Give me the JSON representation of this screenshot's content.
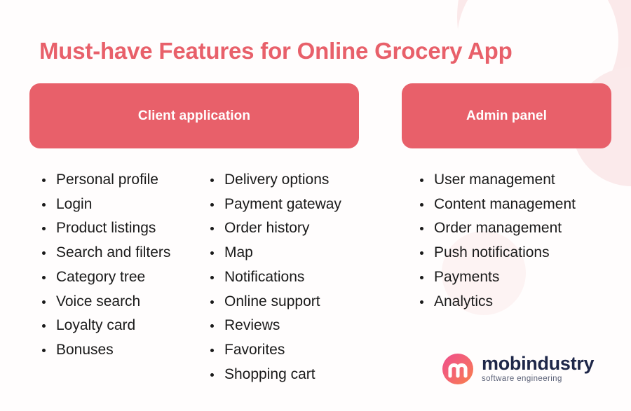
{
  "page": {
    "title": "Must-have Features for Online Grocery App",
    "background_color": "#fffdfd",
    "accent_color": "#e8606a",
    "text_color": "#1a1a1a"
  },
  "sections": [
    {
      "id": "client-application",
      "heading": "Client application",
      "columns": [
        {
          "items": [
            "Personal profile",
            "Login",
            "Product listings",
            "Search and filters",
            "Category tree",
            "Voice search",
            "Loyalty card",
            "Bonuses"
          ]
        },
        {
          "items": [
            "Delivery options",
            "Payment gateway",
            "Order history",
            "Map",
            "Notifications",
            "Online support",
            "Reviews",
            "Favorites",
            "Shopping cart"
          ]
        }
      ]
    },
    {
      "id": "admin-panel",
      "heading": "Admin panel",
      "columns": [
        {
          "items": [
            "User management",
            "Content management",
            "Order management",
            "Push notifications",
            "Payments",
            "Analytics"
          ]
        }
      ]
    }
  ],
  "logo": {
    "icon": "mobindustry-monogram-icon",
    "name": "mobindustry",
    "tagline": "software engineering",
    "name_color": "#1e2749",
    "gradient_from": "#ef4e8c",
    "gradient_to": "#f98149"
  }
}
